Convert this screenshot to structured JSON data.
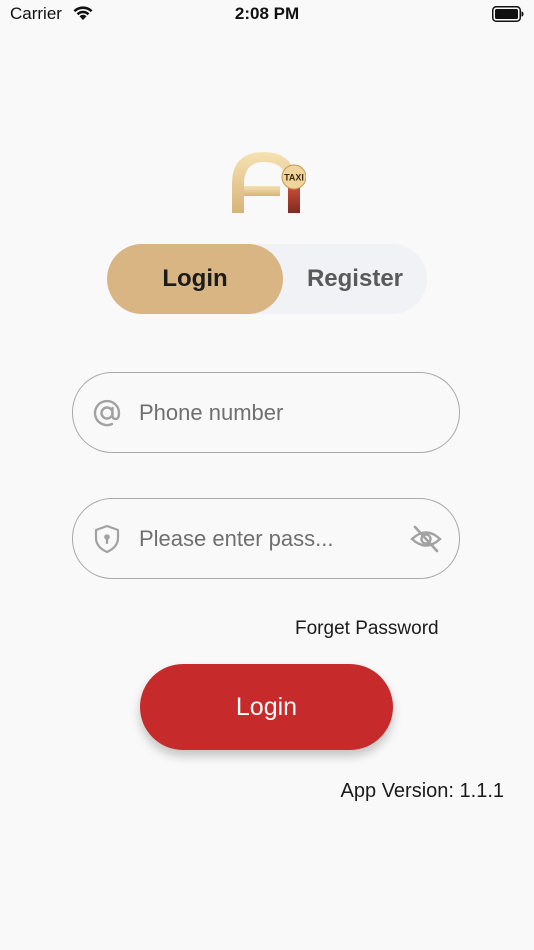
{
  "status_bar": {
    "carrier": "Carrier",
    "time": "2:08 PM",
    "wifi_icon": "wifi-icon",
    "battery_icon": "battery-full-icon"
  },
  "logo": {
    "badge_text": "TAXI",
    "colors": {
      "gold": "#e8c98e",
      "red": "#a3392d"
    }
  },
  "tabs": {
    "items": [
      {
        "label": "Login",
        "active": true
      },
      {
        "label": "Register",
        "active": false
      }
    ],
    "active_color": "#d8b582",
    "inactive_bg": "#f1f2f6"
  },
  "form": {
    "phone": {
      "placeholder": "Phone number",
      "value": "",
      "icon": "at-sign-icon"
    },
    "password": {
      "placeholder": "Please enter pass...",
      "value": "",
      "icon": "shield-lock-icon",
      "toggle_icon": "eye-off-icon"
    },
    "forget_label": "Forget Password",
    "submit_label": "Login",
    "submit_color": "#c62a2a"
  },
  "footer": {
    "version_text": "App Version: 1.1.1"
  }
}
